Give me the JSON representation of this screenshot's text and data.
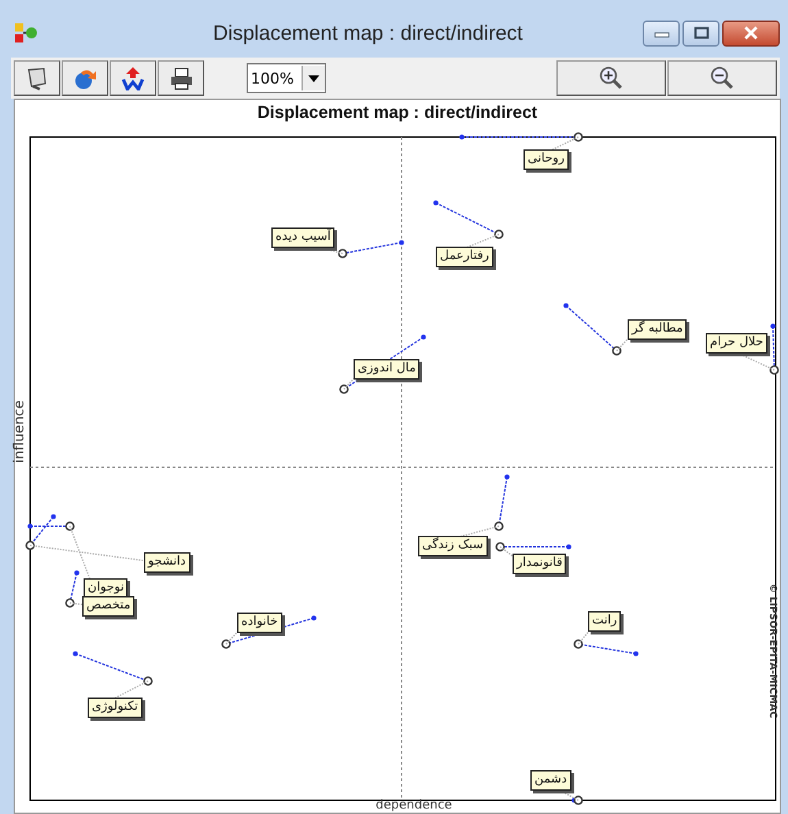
{
  "window": {
    "title": "Displacement map :  direct/indirect"
  },
  "toolbar": {
    "zoom": "100%"
  },
  "map": {
    "title": "Displacement map :  direct/indirect",
    "x_axis_label": "dependence",
    "y_axis_label": "influence",
    "copyright": "© LIPSOR-EPITA-MICMAC",
    "variables": [
      {
        "label": "روحانی"
      },
      {
        "label": "آسیب دیده"
      },
      {
        "label": "رفتارعمل"
      },
      {
        "label": "مطالبه گر"
      },
      {
        "label": "حلال حرام"
      },
      {
        "label": "مال اندوزی"
      },
      {
        "label": "دانشجو"
      },
      {
        "label": "نوجوان"
      },
      {
        "label": "متخصص"
      },
      {
        "label": "خانواده"
      },
      {
        "label": "تکنولوژی"
      },
      {
        "label": "سبک زندگی"
      },
      {
        "label": "قانونمدار"
      },
      {
        "label": "رانت"
      },
      {
        "label": "دشمن"
      }
    ]
  }
}
